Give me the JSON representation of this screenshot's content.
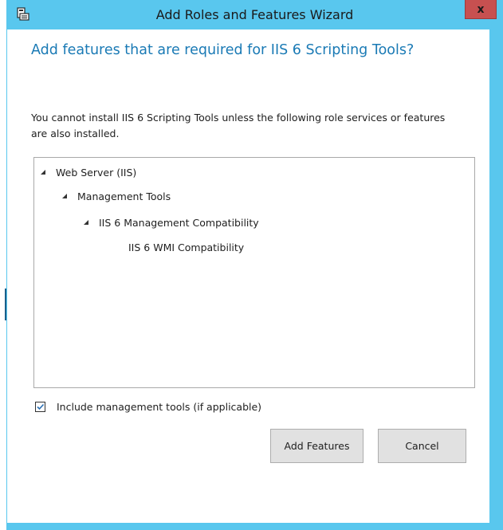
{
  "window": {
    "title": "Add Roles and Features Wizard",
    "close_glyph": "x",
    "title_icon": "server-manager-icon",
    "colors": {
      "frame": "#59c7ee",
      "close": "#c75050",
      "heading": "#1a7ab5"
    }
  },
  "dialog": {
    "heading": "Add features that are required for IIS 6 Scripting Tools?",
    "description": "You cannot install IIS 6 Scripting Tools unless the following role services or features are also installed.",
    "tree": [
      {
        "label": "Web Server (IIS)",
        "level": 0,
        "expanded": true
      },
      {
        "label": "Management Tools",
        "level": 1,
        "expanded": true
      },
      {
        "label": "IIS 6 Management Compatibility",
        "level": 2,
        "expanded": true
      },
      {
        "label": "IIS 6 WMI Compatibility",
        "level": 3,
        "expanded": null
      }
    ],
    "include_tools": {
      "label": "Include management tools (if applicable)",
      "checked": true
    },
    "buttons": {
      "add_features": "Add Features",
      "cancel": "Cancel"
    }
  }
}
